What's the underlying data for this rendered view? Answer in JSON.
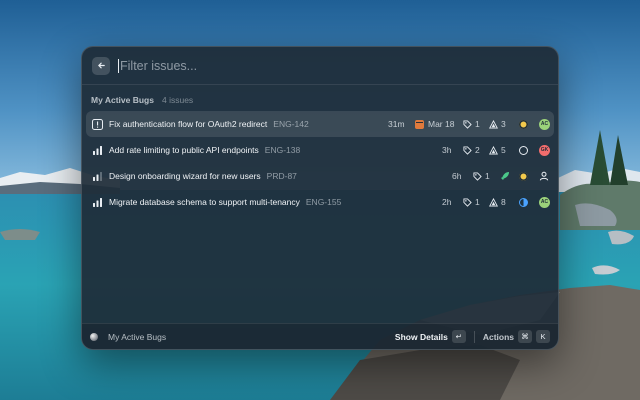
{
  "search": {
    "placeholder": "Filter issues..."
  },
  "section": {
    "title": "My Active Bugs",
    "count": "4 issues"
  },
  "issues": [
    {
      "priority": "urgent",
      "title": "Fix authentication flow for OAuth2 redirect",
      "identifier": "ENG-142",
      "age": "31m",
      "due_date": "Mar 18",
      "labels": "1",
      "estimate": "3",
      "status": "in-progress",
      "assignee": "AC",
      "assignee_color": "#9bd27a",
      "selected": true
    },
    {
      "priority": "high",
      "title": "Add rate limiting to public API endpoints",
      "identifier": "ENG-138",
      "age": "3h",
      "labels": "2",
      "estimate": "5",
      "status": "todo",
      "assignee": "GK",
      "assignee_color": "#f26d6d"
    },
    {
      "priority": "medium",
      "title": "Design onboarding wizard for new users",
      "identifier": "PRD-87",
      "age": "6h",
      "labels": "1",
      "project_icon": "rocket-icon",
      "status": "in-progress",
      "assignee": "unassigned"
    },
    {
      "priority": "high",
      "title": "Migrate database schema to support multi-tenancy",
      "identifier": "ENG-155",
      "age": "2h",
      "labels": "1",
      "estimate": "8",
      "status": "in-review",
      "assignee": "AC",
      "assignee_color": "#9bd27a"
    }
  ],
  "footer": {
    "title": "My Active Bugs",
    "primary_action": "Show Details",
    "primary_shortcut": "↵",
    "actions_label": "Actions",
    "actions_shortcut_mod": "⌘",
    "actions_shortcut_key": "K"
  },
  "colors": {
    "status_in_progress": "#f2c94c",
    "status_in_review": "#4aa3ff",
    "rocket": "#4bc98a"
  }
}
